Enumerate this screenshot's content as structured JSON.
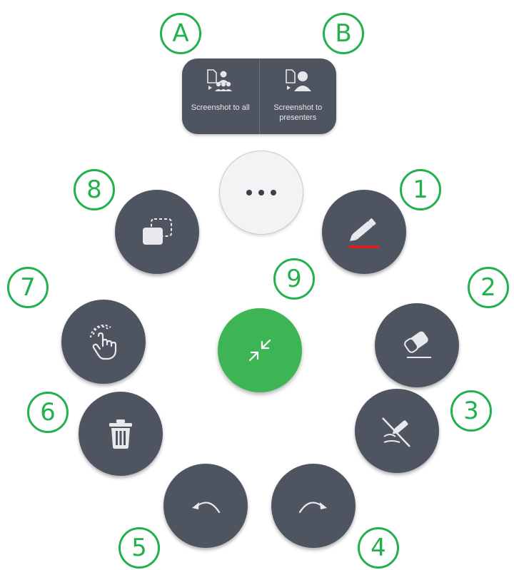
{
  "callouts": {
    "a": "A",
    "b": "B",
    "n1": "1",
    "n2": "2",
    "n3": "3",
    "n4": "4",
    "n5": "5",
    "n6": "6",
    "n7": "7",
    "n8": "8",
    "n9": "9"
  },
  "screenshot_menu": {
    "to_all_label": "Screenshot to all",
    "to_presenters_label": "Screenshot to presenters"
  },
  "icons": {
    "more": "more-icon",
    "pen": "pen-icon",
    "eraser": "eraser-icon",
    "clear_mine": "clear-my-annotations-icon",
    "redo": "redo-icon",
    "undo": "undo-icon",
    "delete": "trash-icon",
    "touch": "touch-icon",
    "switch": "switch-screen-icon",
    "collapse": "collapse-icon"
  },
  "colors": {
    "accent_green": "#22b14c",
    "collapse_green": "#3db554",
    "button_dark": "#4f5560",
    "pen_color": "#e02020"
  }
}
